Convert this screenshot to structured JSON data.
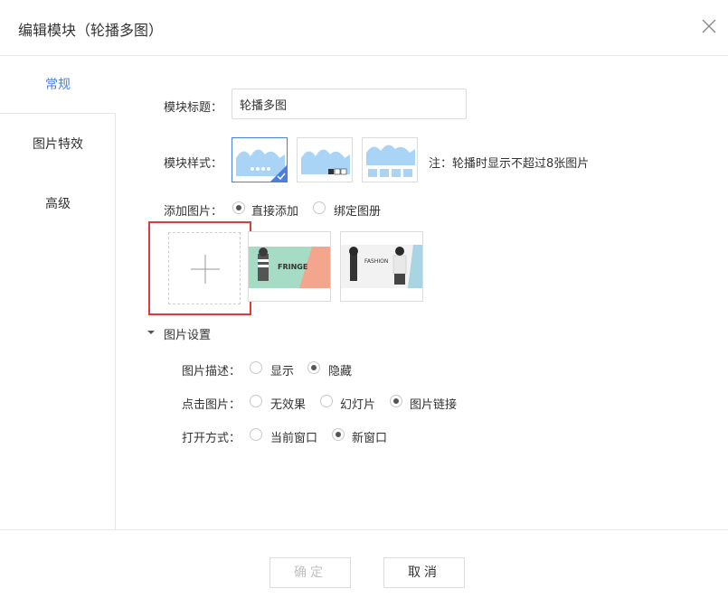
{
  "dialog": {
    "title": "编辑模块（轮播多图）"
  },
  "sidebar": {
    "items": [
      {
        "label": "常规"
      },
      {
        "label": "图片特效"
      },
      {
        "label": "高级"
      }
    ]
  },
  "form": {
    "module_title_label": "模块标题：",
    "module_title_value": "轮播多图",
    "module_style_label": "模块样式：",
    "style_note": "注：轮播时显示不超过8张图片",
    "add_picture_label": "添加图片：",
    "add_options": [
      {
        "label": "直接添加",
        "checked": true
      },
      {
        "label": "绑定图册",
        "checked": false
      }
    ],
    "thumbnails": [
      {
        "caption": "FRINGE"
      },
      {
        "caption": "FASHION"
      }
    ],
    "picture_settings_label": "图片设置",
    "picture_desc_label": "图片描述：",
    "picture_desc_options": [
      {
        "label": "显示",
        "checked": false
      },
      {
        "label": "隐藏",
        "checked": true
      }
    ],
    "click_picture_label": "点击图片：",
    "click_options": [
      {
        "label": "无效果",
        "checked": false
      },
      {
        "label": "幻灯片",
        "checked": false
      },
      {
        "label": "图片链接",
        "checked": true
      }
    ],
    "open_mode_label": "打开方式：",
    "open_options": [
      {
        "label": "当前窗口",
        "checked": false
      },
      {
        "label": "新窗口",
        "checked": true
      }
    ]
  },
  "footer": {
    "confirm_label": "确定",
    "cancel_label": "取消"
  },
  "colors": {
    "accent": "#4a7fdc",
    "highlight_border": "#e03a3a",
    "thumb_blue": "#a9d4f5"
  }
}
